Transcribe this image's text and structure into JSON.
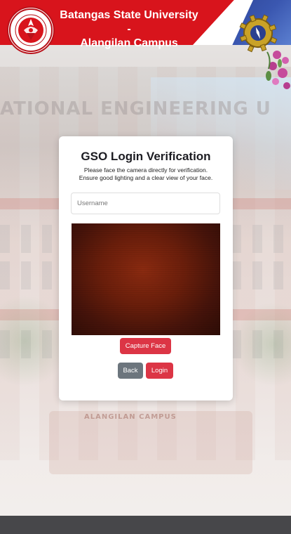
{
  "header": {
    "title_line1": "Batangas State University -",
    "title_line2": "Alangilan Campus",
    "logo_icon": "university-seal-icon",
    "emblem_icon": "engineering-gear-emblem-icon",
    "brand_color": "#d8141c"
  },
  "background": {
    "building_text": "ATIONAL ENGINEERING U",
    "gate_text": "ALANGILAN CAMPUS"
  },
  "login": {
    "title": "GSO Login Verification",
    "instructions_line1": "Please face the camera directly for verification.",
    "instructions_line2": "Ensure good lighting and a clear view of your face.",
    "username_placeholder": "Username",
    "username_value": "",
    "capture_label": "Capture Face",
    "back_label": "Back",
    "login_label": "Login",
    "primary_color": "#dc3545",
    "secondary_color": "#6c757d"
  }
}
